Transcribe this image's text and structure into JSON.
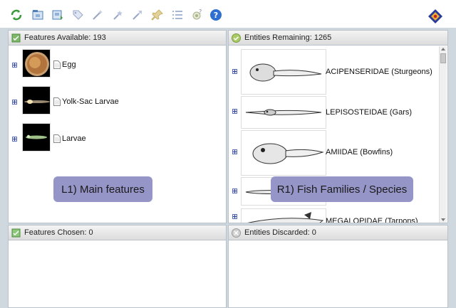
{
  "toolbar": {
    "buttons": [
      {
        "name": "refresh-icon",
        "color": "#3a9a3a"
      },
      {
        "name": "open-icon",
        "color": "#4d7fb8"
      },
      {
        "name": "save-icon",
        "color": "#4d7fb8"
      },
      {
        "name": "tag-icon",
        "color": "#9aa7c4"
      },
      {
        "name": "magic-wand-icon",
        "color": "#9aa7c4"
      },
      {
        "name": "wand-star-icon",
        "color": "#9aa7c4"
      },
      {
        "name": "wand-arrow-icon",
        "color": "#9aa7c4"
      },
      {
        "name": "pin-icon",
        "color": "#c7b06a"
      },
      {
        "name": "list-icon",
        "color": "#8a9ec4"
      },
      {
        "name": "settings-help-icon",
        "color": "#a9b28a"
      },
      {
        "name": "help-icon",
        "color": "#2f6fd0"
      }
    ],
    "logo": "logo-icon"
  },
  "left_top": {
    "header": "Features Available: 193",
    "items": [
      {
        "label": "Egg"
      },
      {
        "label": "Yolk-Sac Larvae"
      },
      {
        "label": "Larvae"
      }
    ]
  },
  "right_top": {
    "header": "Entities Remaining: 1265",
    "items": [
      {
        "label": "ACIPENSERIDAE (Sturgeons)"
      },
      {
        "label": "LEPISOSTEIDAE (Gars)"
      },
      {
        "label": "AMIIDAE (Bowfins)"
      },
      {
        "label": ""
      },
      {
        "label": "MEGALOPIDAE (Tarpons)"
      }
    ]
  },
  "left_bottom": {
    "header": "Features Chosen: 0"
  },
  "right_bottom": {
    "header": "Entities Discarded: 0"
  },
  "callouts": {
    "left": "L1) Main features",
    "right": "R1) Fish Families / Species"
  },
  "colors": {
    "callout_bg": "#9595c8",
    "panel_border": "#b9c2cb"
  }
}
